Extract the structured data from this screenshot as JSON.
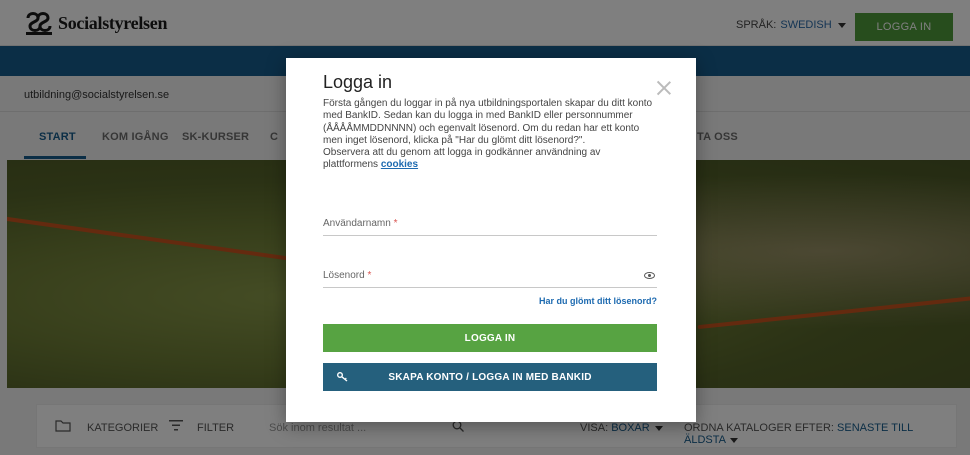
{
  "header": {
    "logo_text": "Socialstyrelsen",
    "language_label": "SPRÅK:",
    "language_value": "SWEDISH",
    "login_button": "LOGGA IN"
  },
  "user_email": "utbildning@socialstyrelsen.se",
  "nav": {
    "items": [
      {
        "label": "START"
      },
      {
        "label": "KOM IGÅNG"
      },
      {
        "label": "SK-KURSER"
      },
      {
        "label": "C"
      },
      {
        "label": "TA OSS"
      }
    ]
  },
  "filterbar": {
    "categories": "KATEGORIER",
    "filter": "FILTER",
    "search_placeholder": "Sök inom resultat ...",
    "view_label": "VISA:",
    "view_value": "BOXAR",
    "sort_label": "ORDNA KATALOGER EFTER:",
    "sort_value": "SENASTE TILL ÄLDSTA"
  },
  "modal": {
    "title": "Logga in",
    "body_text": "Första gången du loggar in på nya utbildningsportalen skapar du ditt konto med BankID. Sedan kan du logga in med BankID eller personnummer (ÅÅÅÅMMDDNNNN) och egenvalt lösenord. Om du redan har ett konto men inget lösenord, klicka på \"Har du glömt ditt lösenord?\".",
    "body_text2": "Observera att du genom att logga in godkänner användning av plattformens",
    "cookies_link": "cookies",
    "username_label": "Användarnamn",
    "password_label": "Lösenord",
    "required_mark": "*",
    "forgot_link": "Har du glömt ditt lösenord?",
    "login_button": "LOGGA IN",
    "bankid_button": "SKAPA KONTO / LOGGA IN MED BANKID"
  },
  "colors": {
    "brand_blue": "#165c8c",
    "green": "#57a342",
    "bankid_button": "#25607d"
  }
}
